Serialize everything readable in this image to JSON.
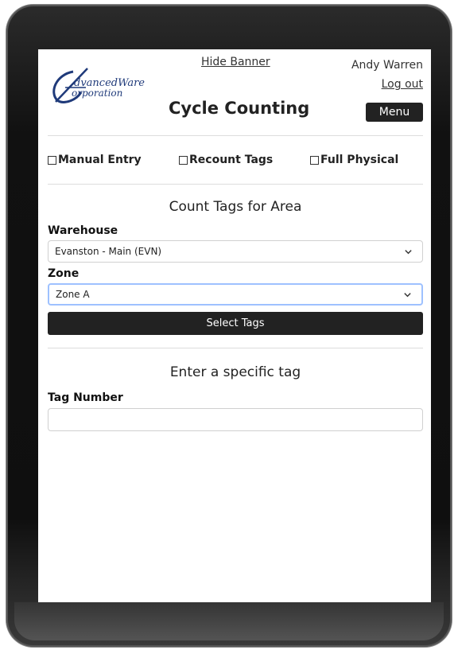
{
  "header": {
    "logo_text_line1": "dvancedWare",
    "logo_text_line2": "orporation",
    "hide_banner": "Hide Banner",
    "title": "Cycle Counting",
    "user_name": "Andy Warren",
    "logout": "Log out",
    "menu": "Menu"
  },
  "options": [
    {
      "label": "Manual Entry",
      "checked": false
    },
    {
      "label": "Recount Tags",
      "checked": false
    },
    {
      "label": "Full Physical",
      "checked": false
    }
  ],
  "area": {
    "title": "Count Tags for Area",
    "warehouse_label": "Warehouse",
    "warehouse_value": "Evanston - Main (EVN)",
    "zone_label": "Zone",
    "zone_value": "Zone A",
    "select_button": "Select Tags"
  },
  "specific": {
    "title": "Enter a specific tag",
    "tag_label": "Tag Number",
    "tag_value": ""
  }
}
